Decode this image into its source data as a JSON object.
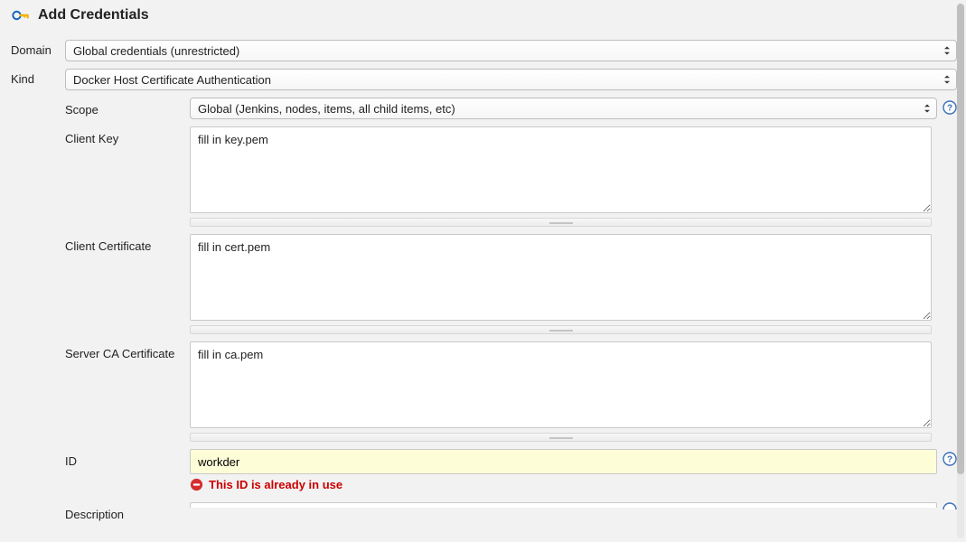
{
  "header": {
    "title": "Add Credentials"
  },
  "domain": {
    "label": "Domain",
    "value": "Global credentials (unrestricted)"
  },
  "kind": {
    "label": "Kind",
    "value": "Docker Host Certificate Authentication"
  },
  "scope": {
    "label": "Scope",
    "value": "Global (Jenkins, nodes, items, all child items, etc)"
  },
  "client_key": {
    "label": "Client Key",
    "value": "fill in key.pem"
  },
  "client_certificate": {
    "label": "Client Certificate",
    "value": "fill in cert.pem"
  },
  "server_ca": {
    "label": "Server CA Certificate",
    "value": "fill in ca.pem"
  },
  "id": {
    "label": "ID",
    "value": "workder",
    "error": "This ID is already in use"
  },
  "description": {
    "label": "Description",
    "value": ""
  }
}
